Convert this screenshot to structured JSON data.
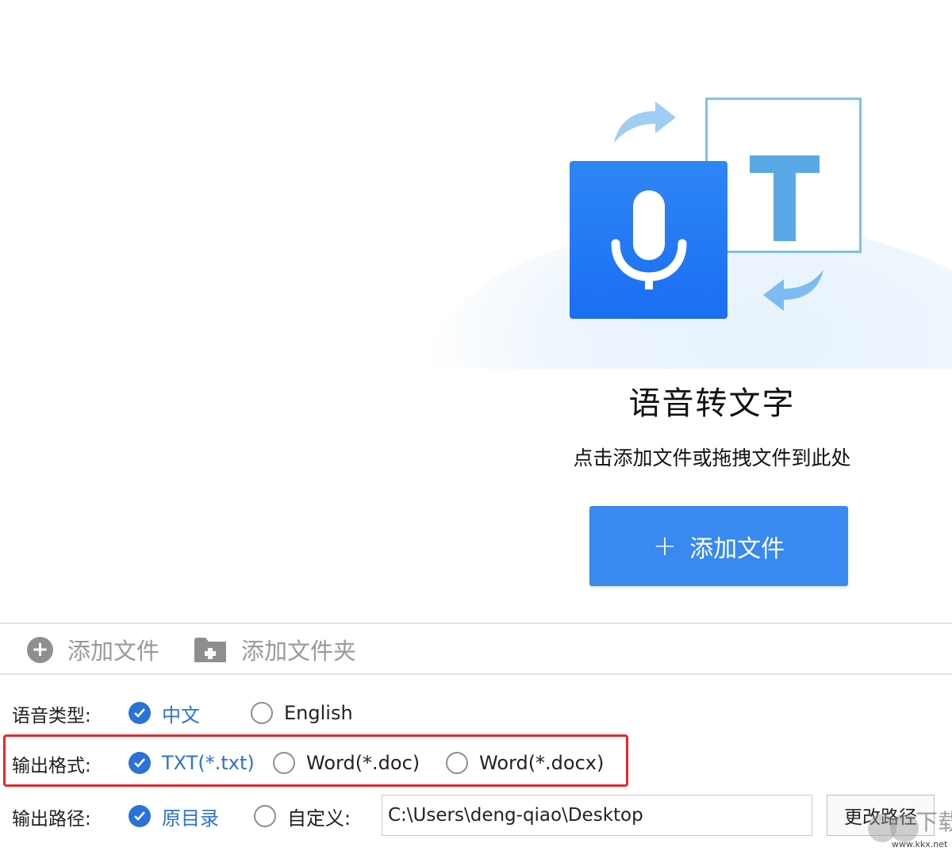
{
  "drop_zone": {
    "title": "语音转文字",
    "hint": "点击添加文件或拖拽文件到此处",
    "add_button_icon": "+",
    "add_button_label": "添加文件",
    "illustration_letter": "T"
  },
  "toolbar": {
    "add_file_label": "添加文件",
    "add_folder_label": "添加文件夹"
  },
  "settings": {
    "language": {
      "label": "语音类型:",
      "options": [
        {
          "label": "中文",
          "selected": true
        },
        {
          "label": "English",
          "selected": false
        }
      ]
    },
    "output_format": {
      "label": "输出格式:",
      "options": [
        {
          "label": "TXT(*.txt)",
          "selected": true
        },
        {
          "label": "Word(*.doc)",
          "selected": false
        },
        {
          "label": "Word(*.docx)",
          "selected": false
        }
      ]
    },
    "output_path": {
      "label": "输出路径:",
      "options": [
        {
          "label": "原目录",
          "selected": true
        },
        {
          "label": "自定义:",
          "selected": false
        }
      ],
      "path_value": "C:\\Users\\deng-qiao\\Desktop",
      "change_button_label": "更改路径"
    }
  },
  "watermark": {
    "text": "下载",
    "url": "www.kkx.net"
  },
  "colors": {
    "accent": "#3889f0",
    "selected_text": "#2a72d8",
    "highlight": "#e8262b",
    "mic_tile": "#1a6ef2",
    "t_letter": "#5aa8e6"
  }
}
